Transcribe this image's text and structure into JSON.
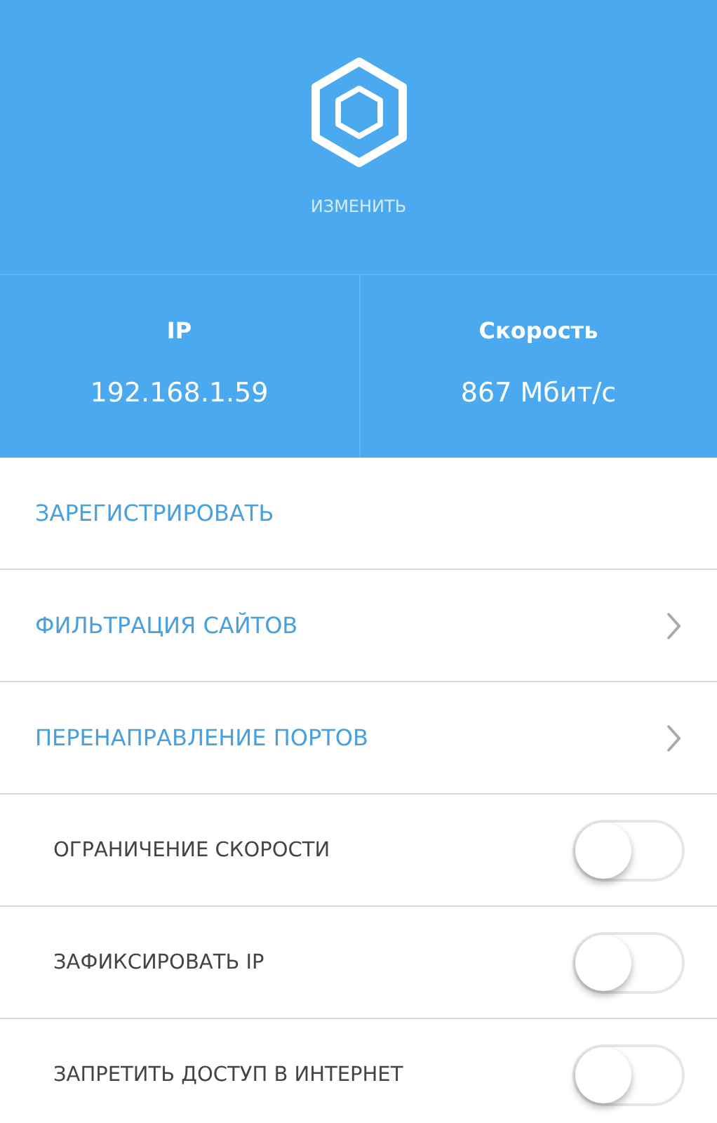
{
  "header": {
    "action": "ИЗМЕНИТЬ"
  },
  "stats": [
    {
      "label": "IP",
      "value": "192.168.1.59"
    },
    {
      "label": "Скорость",
      "value": "867 Мбит/с"
    }
  ],
  "items": [
    {
      "kind": "link",
      "label": "ЗАРЕГИСТРИРОВАТЬ"
    },
    {
      "kind": "nav",
      "label": "ФИЛЬТРАЦИЯ САЙТОВ"
    },
    {
      "kind": "nav",
      "label": "ПЕРЕНАПРАВЛЕНИЕ ПОРТОВ"
    },
    {
      "kind": "toggle",
      "label": "ОГРАНИЧЕНИЕ СКОРОСТИ",
      "on": false
    },
    {
      "kind": "toggle",
      "label": "ЗАФИКСИРОВАТЬ IP",
      "on": false
    },
    {
      "kind": "toggle",
      "label": "ЗАПРЕТИТЬ ДОСТУП В ИНТЕРНЕТ",
      "on": false
    }
  ]
}
